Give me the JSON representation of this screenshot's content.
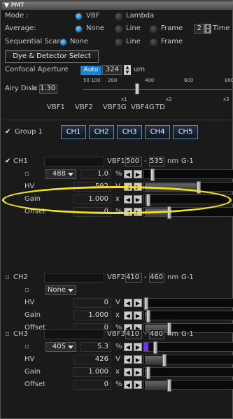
{
  "panel": {
    "title": "PMT"
  },
  "mode": {
    "label": "Mode :",
    "options": [
      "VBF",
      "Lambda"
    ],
    "selected": "VBF"
  },
  "average": {
    "label": "Average:",
    "options": [
      "None",
      "Line",
      "Frame"
    ],
    "selected": "None",
    "count": "2",
    "suffix": "Time"
  },
  "sequential": {
    "label": "Sequential Scan",
    "options": [
      "None",
      "Line",
      "Frame"
    ],
    "selected": "None"
  },
  "dye_button": "Dye & Detector Select",
  "confocal": {
    "label": "Confocal Aperture",
    "auto": "Auto",
    "value": "324",
    "unit": "um"
  },
  "airy": {
    "label": "Airy Disk",
    "prefix": "x",
    "value": "1.30",
    "scale_top": [
      "50 100",
      "200",
      "400",
      "600",
      "800"
    ],
    "scale_marks": [
      "x1",
      "x2",
      "x3"
    ],
    "detectors": [
      "VBF1",
      "VBF2",
      "VBF3G",
      "VBF4G",
      "TD"
    ]
  },
  "group": {
    "label": "Group 1",
    "channels": [
      "CH1",
      "CH2",
      "CH3",
      "CH4",
      "CH5"
    ]
  },
  "channels": [
    {
      "name": "CH1",
      "checked": true,
      "detector": "VBF1",
      "range_from": "500",
      "range_to": "535",
      "unit": "nm",
      "grade": "G-1",
      "laser": "488",
      "laser_value": "1.0",
      "laser_unit": "%",
      "laser_fill": 0.02,
      "laser_color": "#000000",
      "hv": "592",
      "hv_unit": "V",
      "hv_fill": 0.58,
      "gain": "1.000",
      "gain_unit": "x",
      "gain_fill": 0.02,
      "offset": "0",
      "offset_unit": "%",
      "offset_fill": 0.25
    },
    {
      "name": "CH2",
      "checked": false,
      "detector": "VBF2",
      "range_from": "410",
      "range_to": "460",
      "unit": "nm",
      "grade": "G-1",
      "laser": "None",
      "laser_value": "",
      "laser_unit": "",
      "laser_fill": null,
      "hv": "0",
      "hv_unit": "V",
      "hv_fill": 0.0,
      "gain": "1.000",
      "gain_unit": "x",
      "gain_fill": 0.02,
      "offset": "0",
      "offset_unit": "%",
      "offset_fill": 0.25
    },
    {
      "name": "CH3",
      "checked": false,
      "detector": "VBF3G",
      "range_from": "410",
      "range_to": "480",
      "unit": "nm",
      "grade": "G-1",
      "laser": "405",
      "laser_value": "5.3",
      "laser_unit": "%",
      "laser_fill": 0.05,
      "laser_color": "#7a2cff",
      "hv": "426",
      "hv_unit": "V",
      "hv_fill": 0.2,
      "gain": "1.000",
      "gain_unit": "x",
      "gain_fill": 0.02,
      "offset": "0",
      "offset_unit": "%",
      "offset_fill": 0.25
    }
  ],
  "row_labels": {
    "hv": "HV",
    "gain": "Gain",
    "offset": "Offset"
  },
  "colors": {
    "accent": "#1f7fd0",
    "highlight": "#f3e21b",
    "panel_bg": "#1a1a1a"
  }
}
